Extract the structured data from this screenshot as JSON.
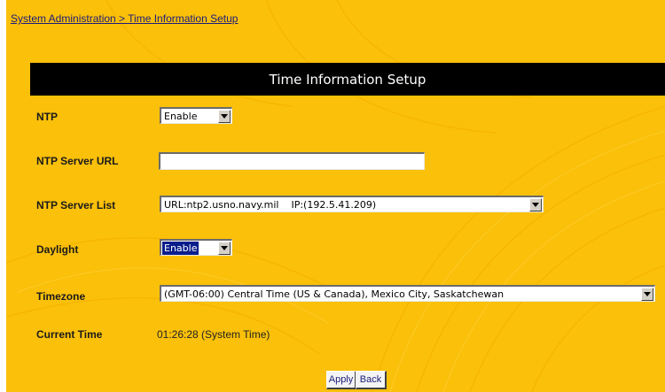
{
  "breadcrumb": "System Administration > Time Information Setup",
  "header": {
    "title": "Time Information Setup"
  },
  "form": {
    "ntp": {
      "label": "NTP",
      "value": "Enable"
    },
    "ntp_server_url": {
      "label": "NTP Server URL",
      "value": ""
    },
    "ntp_server_list": {
      "label": "NTP Server List",
      "value": "URL:ntp2.usno.navy.mil    IP:(192.5.41.209)"
    },
    "daylight": {
      "label": "Daylight",
      "value": "Enable"
    },
    "timezone": {
      "label": "Timezone",
      "value": "(GMT-06:00) Central Time (US & Canada), Mexico City, Saskatchewan"
    },
    "current_time": {
      "label": "Current Time",
      "value": "01:26:28 (System Time)"
    }
  },
  "buttons": {
    "apply": "Apply",
    "back": "Back"
  },
  "colors": {
    "background": "#fac00a",
    "header_bar": "#000000",
    "link": "#1b1b7a",
    "selected_highlight": "#0a1e8c"
  },
  "icons": {
    "dropdown": "chevron-down-icon"
  }
}
